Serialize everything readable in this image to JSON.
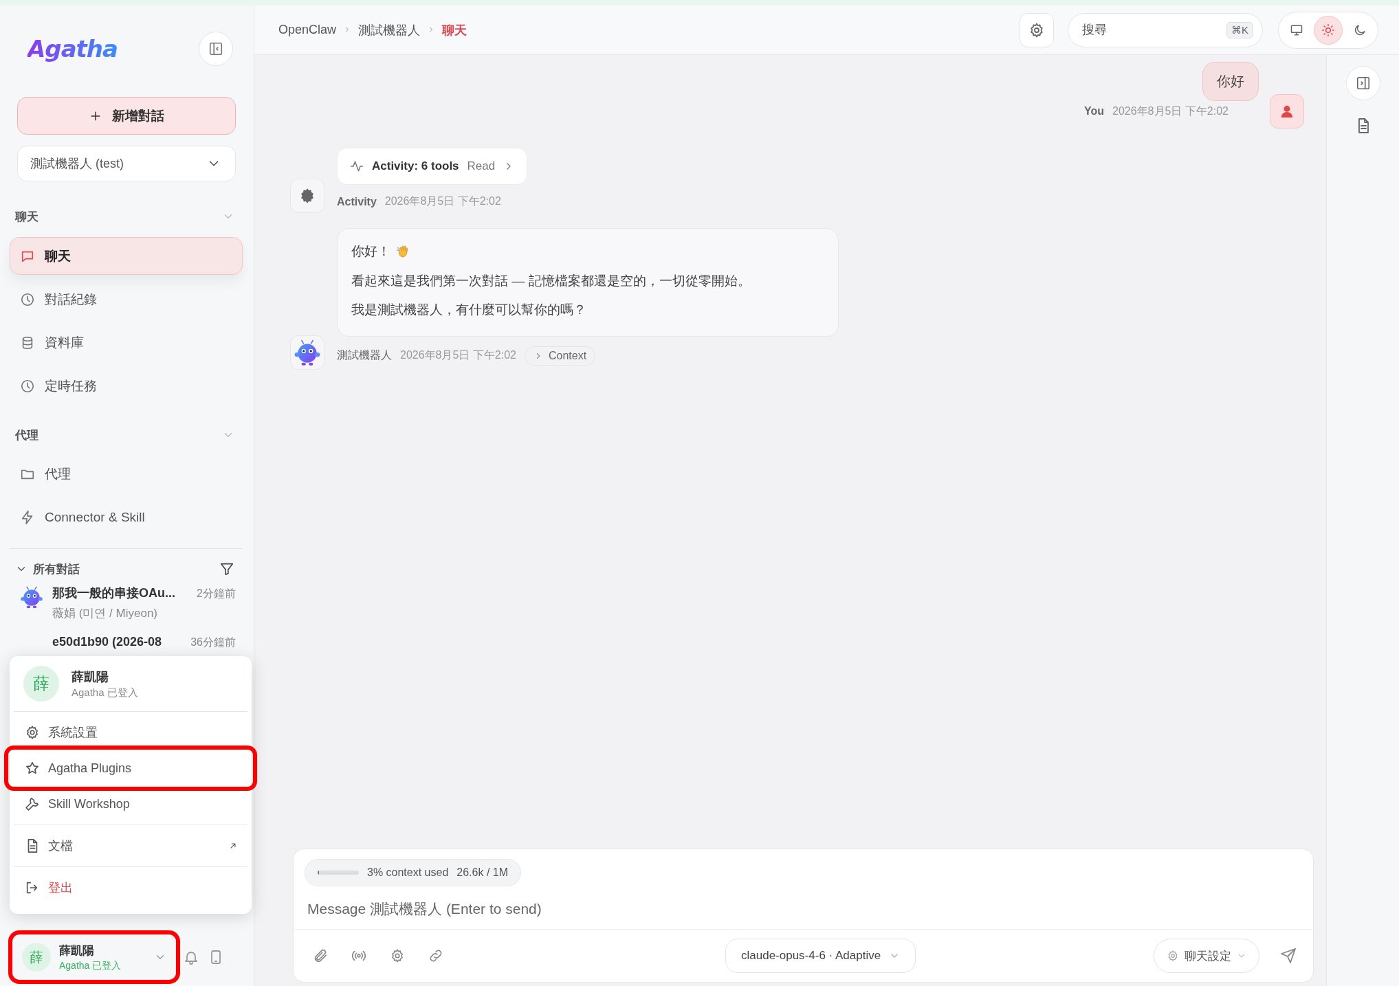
{
  "sidebar": {
    "logo": "Agatha",
    "new_chat_button": "新增對話",
    "bot_select": {
      "value": "測試機器人 (test)"
    },
    "sections": [
      {
        "title": "聊天",
        "expanded": true,
        "items": [
          {
            "label": "聊天",
            "selected": true
          },
          {
            "label": "對話紀錄",
            "selected": false
          },
          {
            "label": "資料庫",
            "selected": false
          },
          {
            "label": "定時任務",
            "selected": false
          }
        ]
      },
      {
        "title": "代理",
        "expanded": true,
        "items": [
          {
            "label": "代理",
            "selected": false
          },
          {
            "label": "Connector & Skill",
            "selected": false
          }
        ]
      }
    ],
    "conversations": {
      "title": "所有對話",
      "expanded": true,
      "items": [
        {
          "title": "那我一般的串接OAu...",
          "time": "2分鐘前",
          "subtitle": "薇娟 (미연 / Miyeon)"
        },
        {
          "title": "e50d1b90 (2026-08",
          "time": "36分鐘前"
        }
      ]
    },
    "user": {
      "avatar": "薛",
      "name": "薛凱陽",
      "status": "Agatha 已登入",
      "highlighted": true
    }
  },
  "user_menu": {
    "open": true,
    "avatar": "薛",
    "name": "薛凱陽",
    "status": "Agatha 已登入",
    "groups": [
      {
        "items": [
          {
            "label": "系統設置",
            "highlighted": false
          },
          {
            "label": "Agatha Plugins",
            "highlighted": true
          },
          {
            "label": "Skill Workshop",
            "highlighted": false
          }
        ]
      },
      {
        "items": [
          {
            "label": "文檔",
            "highlighted": false,
            "external": true
          }
        ]
      },
      {
        "items": [
          {
            "label": "登出",
            "highlighted": false,
            "danger": true
          }
        ]
      }
    ]
  },
  "topbar": {
    "breadcrumbs": [
      {
        "label": "OpenClaw",
        "selected": false
      },
      {
        "label": "測試機器人",
        "selected": false
      },
      {
        "label": "聊天",
        "selected": true
      }
    ],
    "search": {
      "placeholder": "搜尋",
      "shortcut": "⌘K"
    },
    "theme_options": [
      {
        "selected": false
      },
      {
        "selected": true
      },
      {
        "selected": false
      }
    ]
  },
  "messages": [
    {
      "kind": "user",
      "text": "你好",
      "author": "You",
      "time": "2026年8月5日 下午2:02"
    },
    {
      "kind": "activity",
      "title": "Activity: 6 tools",
      "detail": "Read",
      "author": "Activity",
      "time": "2026年8月5日 下午2:02"
    },
    {
      "kind": "assistant",
      "paragraphs": [
        "你好！",
        "看起來這是我們第一次對話 — 記憶檔案都還是空的，一切從零開始。",
        "我是測試機器人，有什麼可以幫你的嗎？"
      ],
      "author": "測試機器人",
      "time": "2026年8月5日 下午2:02",
      "context_label": "Context"
    }
  ],
  "composer": {
    "context": {
      "level": 0.03,
      "label": "3% context used",
      "tokens": "26.6k / 1M"
    },
    "placeholder": "Message 測試機器人 (Enter to send)",
    "model": "claude-opus-4-6 · Adaptive",
    "settings": "聊天設定"
  }
}
